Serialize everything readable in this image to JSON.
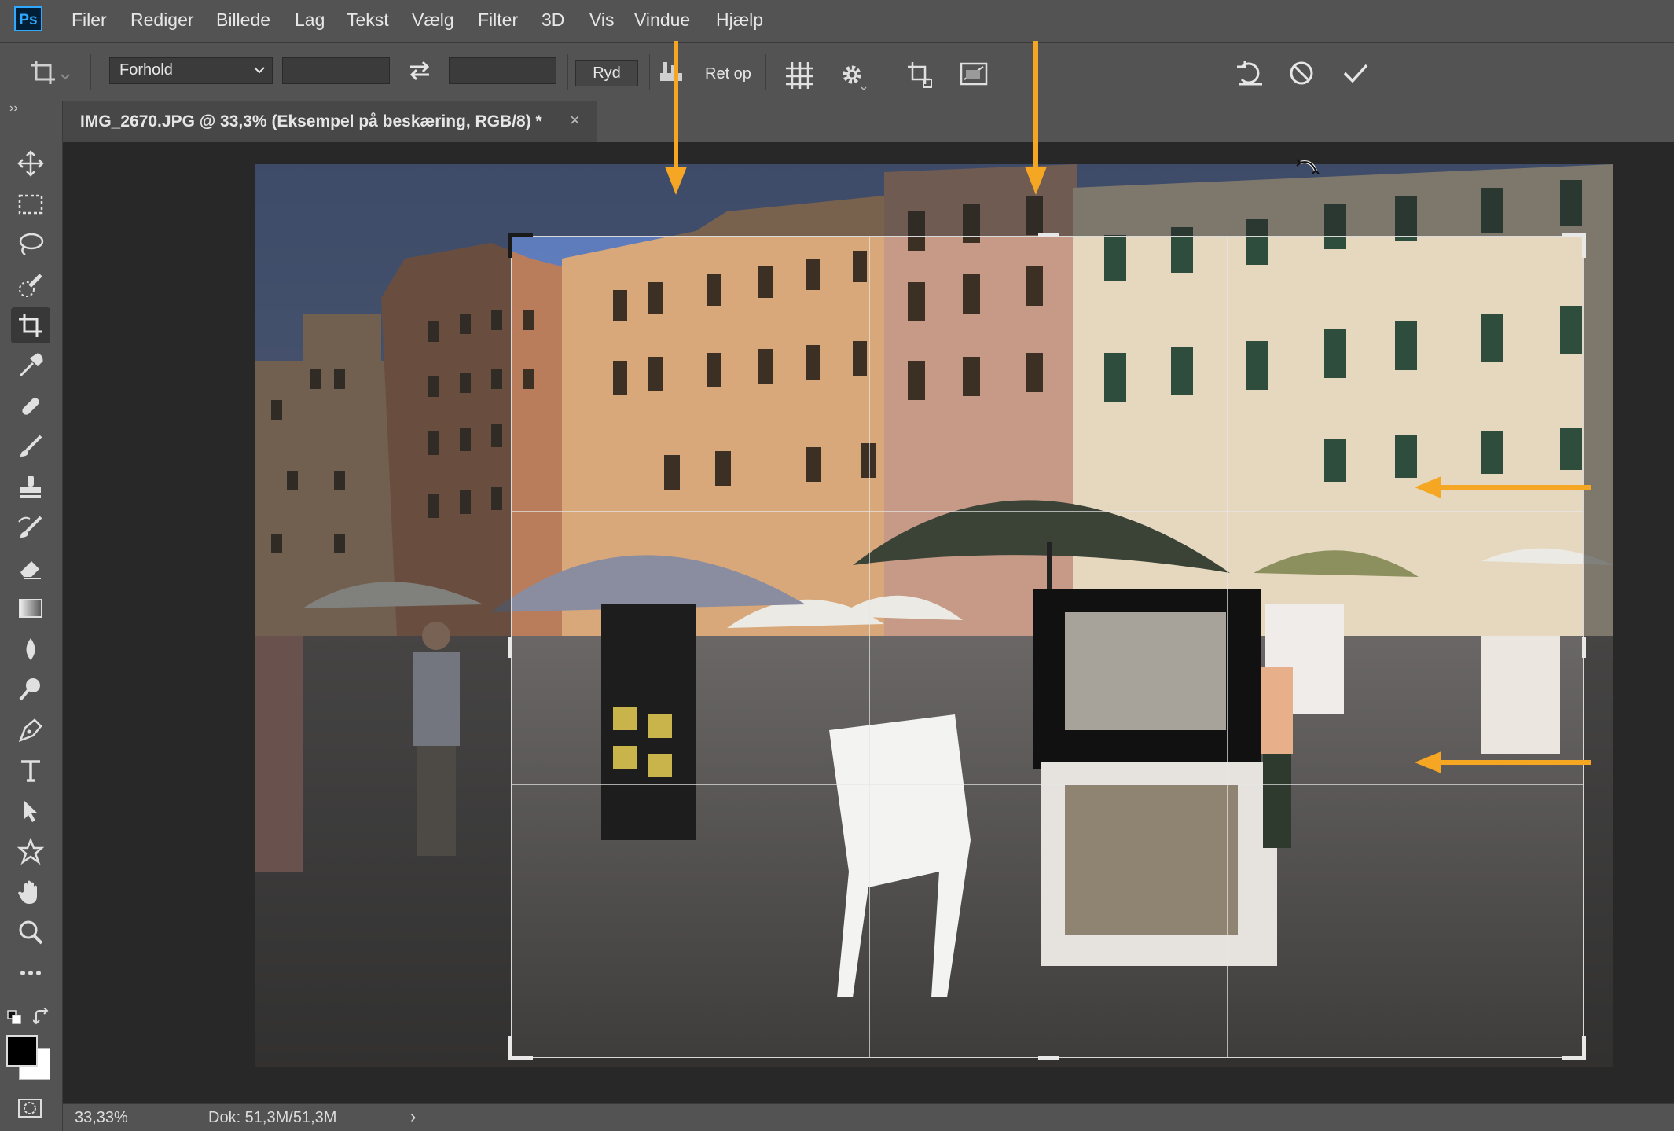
{
  "app": {
    "logo": "Ps"
  },
  "menu": [
    "Filer",
    "Rediger",
    "Billede",
    "Lag",
    "Tekst",
    "Vælg",
    "Filter",
    "3D",
    "Vis",
    "Vindue",
    "Hjælp"
  ],
  "options": {
    "ratio_select": "Forhold",
    "clear_label": "Ryd",
    "straighten_label": "Ret op"
  },
  "panel_toggle": "››",
  "document": {
    "tab_title": "IMG_2670.JPG @ 33,3% (Eksempel på beskæring, RGB/8) *",
    "close": "×"
  },
  "status": {
    "zoom": "33,33%",
    "doc_size": "Dok: 51,3M/51,3M",
    "arrow": "›"
  },
  "tools": [
    "move-icon",
    "marquee-icon",
    "lasso-icon",
    "quick-select-icon",
    "crop-icon",
    "eyedropper-icon",
    "healing-icon",
    "brush-icon",
    "stamp-icon",
    "history-brush-icon",
    "eraser-icon",
    "gradient-icon",
    "blur-icon",
    "dodge-icon",
    "pen-icon",
    "type-icon",
    "path-select-icon",
    "custom-shape-icon",
    "hand-icon",
    "zoom-icon",
    "more-icon"
  ],
  "colors": {
    "annotation_arrow": "#f5a623",
    "foreground": "#000000",
    "background": "#ffffff"
  }
}
